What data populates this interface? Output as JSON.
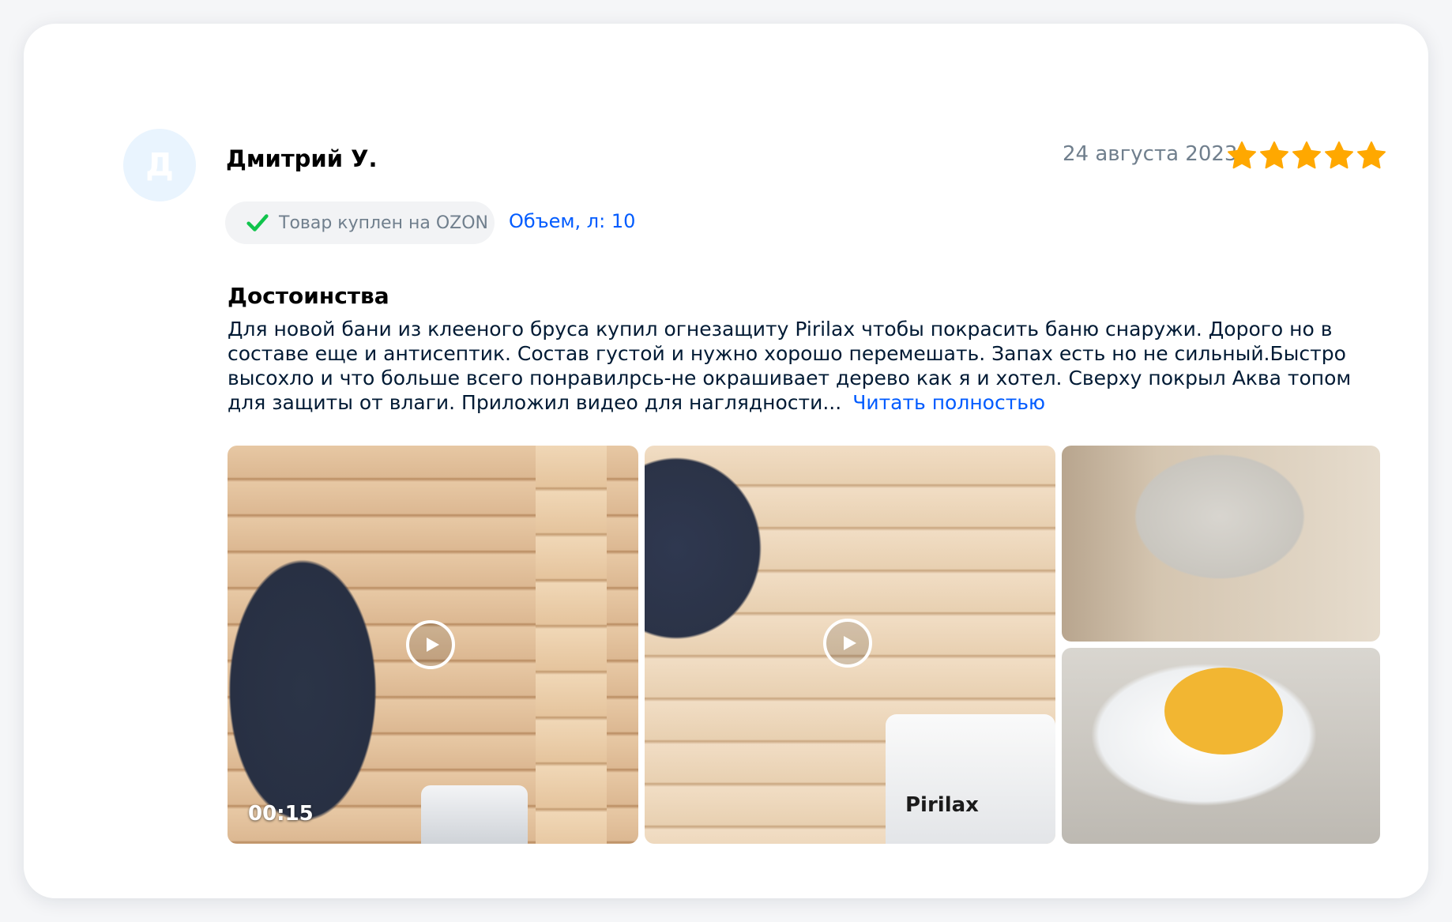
{
  "review": {
    "avatar_letter": "Д",
    "author": "Дмитрий У.",
    "date": "24 августа 2023",
    "rating": 5,
    "rating_max": 5,
    "star_color": "#ffa800",
    "purchased_label": "Товар куплен на OZON",
    "variant": "Объем, л: 10",
    "section_title": "Достоинства",
    "text": "Для новой бани из клееного бруса купил огнезащиту Pirilax чтобы покрасить баню снаружи. Дорого но в составе еще и антисептик. Состав густой и нужно хорошо перемешать. Запах есть но не сильный.Быстро высохло и что больше всего понравилрсь-не окрашивает дерево как я и хотел. Сверху покрыл Аква топом для защиты от влаги. Приложил видео для наглядности...",
    "read_more": "Читать полностью"
  },
  "media": {
    "video1_duration": "00:15",
    "video2_label": "Pirilax"
  },
  "colors": {
    "accent": "#005bff",
    "check": "#10c44c",
    "muted": "#707f8d",
    "avatar_bg": "#e9f4fe"
  }
}
